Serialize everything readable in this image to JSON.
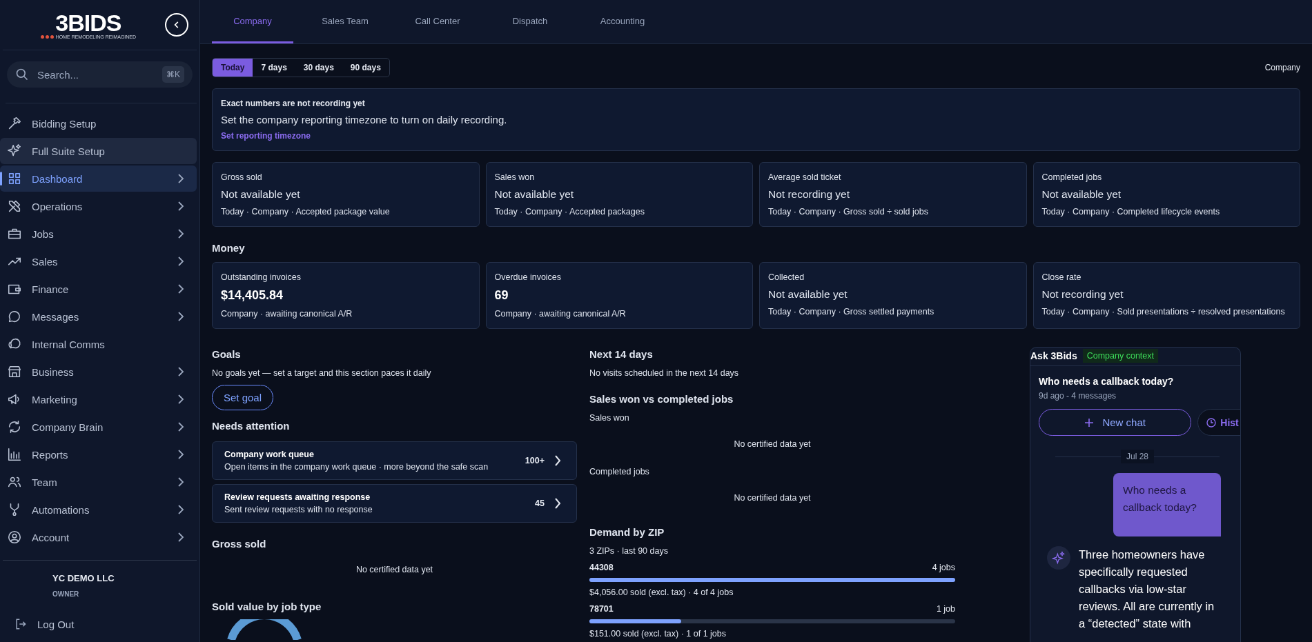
{
  "sidebar": {
    "logo": {
      "wordmark": "3BIDS",
      "tagline": "HOME REMODELING REIMAGINED"
    },
    "search": {
      "placeholder": "Search...",
      "shortcut": "⌘K"
    },
    "items": [
      {
        "label": "Bidding Setup",
        "selected": false,
        "highlighted": false,
        "chevron": false
      },
      {
        "label": "Full Suite Setup",
        "selected": false,
        "highlighted": true,
        "chevron": false
      },
      {
        "label": "Dashboard",
        "selected": true,
        "highlighted": false,
        "chevron": true
      },
      {
        "label": "Operations",
        "selected": false,
        "highlighted": false,
        "chevron": true
      },
      {
        "label": "Jobs",
        "selected": false,
        "highlighted": false,
        "chevron": true
      },
      {
        "label": "Sales",
        "selected": false,
        "highlighted": false,
        "chevron": true
      },
      {
        "label": "Finance",
        "selected": false,
        "highlighted": false,
        "chevron": true
      },
      {
        "label": "Messages",
        "selected": false,
        "highlighted": false,
        "chevron": true
      },
      {
        "label": "Internal Comms",
        "selected": false,
        "highlighted": false,
        "chevron": false
      },
      {
        "label": "Business",
        "selected": false,
        "highlighted": false,
        "chevron": true
      },
      {
        "label": "Marketing",
        "selected": false,
        "highlighted": false,
        "chevron": true
      },
      {
        "label": "Company Brain",
        "selected": false,
        "highlighted": false,
        "chevron": true
      },
      {
        "label": "Reports",
        "selected": false,
        "highlighted": false,
        "chevron": true
      },
      {
        "label": "Team",
        "selected": false,
        "highlighted": false,
        "chevron": true
      },
      {
        "label": "Automations",
        "selected": false,
        "highlighted": false,
        "chevron": true
      },
      {
        "label": "Account",
        "selected": false,
        "highlighted": false,
        "chevron": true
      }
    ],
    "account": {
      "name": "YC DEMO LLC",
      "role": "OWNER"
    },
    "logout": "Log Out"
  },
  "tabs": [
    {
      "label": "Company",
      "selected": true
    },
    {
      "label": "Sales Team",
      "selected": false
    },
    {
      "label": "Call Center",
      "selected": false
    },
    {
      "label": "Dispatch",
      "selected": false
    },
    {
      "label": "Accounting",
      "selected": false
    }
  ],
  "ranges": [
    {
      "label": "Today",
      "selected": true
    },
    {
      "label": "7 days",
      "selected": false
    },
    {
      "label": "30 days",
      "selected": false
    },
    {
      "label": "90 days",
      "selected": false
    }
  ],
  "scope": "Company",
  "banner": {
    "title": "Exact numbers are not recording yet",
    "body": "Set the company reporting timezone to turn on daily recording.",
    "link": "Set reporting timezone"
  },
  "kpis": [
    {
      "label": "Gross sold",
      "value": "Not available yet",
      "note": "Today · Company · Accepted package value"
    },
    {
      "label": "Sales won",
      "value": "Not available yet",
      "note": "Today · Company · Accepted packages"
    },
    {
      "label": "Average sold ticket",
      "value": "Not recording yet",
      "note": "Today · Company · Gross sold ÷ sold jobs"
    },
    {
      "label": "Completed jobs",
      "value": "Not available yet",
      "note": "Today · Company · Completed lifecycle events"
    }
  ],
  "money": {
    "heading": "Money",
    "cards": [
      {
        "label": "Outstanding invoices",
        "value": "$14,405.84",
        "emphasis": true,
        "note": "Company · awaiting canonical A/R"
      },
      {
        "label": "Overdue invoices",
        "value": "69",
        "emphasis": true,
        "note": "Company · awaiting canonical A/R"
      },
      {
        "label": "Collected",
        "value": "Not available yet",
        "emphasis": false,
        "note": "Today · Company · Gross settled payments"
      },
      {
        "label": "Close rate",
        "value": "Not recording yet",
        "emphasis": false,
        "note": "Today · Company · Sold presentations ÷ resolved presentations"
      }
    ]
  },
  "goals": {
    "heading": "Goals",
    "text": "No goals yet — set a target and this section paces it daily",
    "button": "Set goal"
  },
  "needs_attention": {
    "heading": "Needs attention",
    "items": [
      {
        "title": "Company work queue",
        "detail": "Open items in the company work queue · more beyond the safe scan",
        "count": "100+"
      },
      {
        "title": "Review requests awaiting response",
        "detail": "Sent review requests with no response",
        "count": "45"
      }
    ]
  },
  "gross_sold": {
    "heading": "Gross sold",
    "empty": "No certified data yet"
  },
  "sold_by_type": {
    "heading": "Sold value by job type"
  },
  "next_14": {
    "heading": "Next 14 days",
    "text": "No visits scheduled in the next 14 days"
  },
  "won_vs_completed": {
    "heading": "Sales won vs completed jobs",
    "series": [
      {
        "label": "Sales won",
        "empty": "No certified data yet"
      },
      {
        "label": "Completed jobs",
        "empty": "No certified data yet"
      }
    ]
  },
  "demand_by_zip": {
    "heading": "Demand by ZIP",
    "summary": "3 ZIPs · last 90 days",
    "rows": [
      {
        "zip": "44308",
        "jobs": "4 jobs",
        "level": 1,
        "detail": "$4,056.00 sold (excl. tax) · 4 of 4 jobs"
      },
      {
        "zip": "78701",
        "jobs": "1 job",
        "level": 0.25,
        "detail": "$151.00 sold (excl. tax) · 1 of 1 jobs"
      }
    ]
  },
  "assistant": {
    "title": "Ask 3Bids",
    "context": "Company context",
    "thread_title": "Who needs a callback today?",
    "thread_meta": "9d ago - 4 messages",
    "new_chat": "New chat",
    "history": "Hist",
    "date": "Jul 28",
    "messages": [
      {
        "kind": "question",
        "text": "Who needs a callback today?"
      },
      {
        "kind": "answer",
        "text": "Three homeowners have specifically requested callbacks via low-star reviews. All are currently in a “detected” state with"
      }
    ]
  }
}
